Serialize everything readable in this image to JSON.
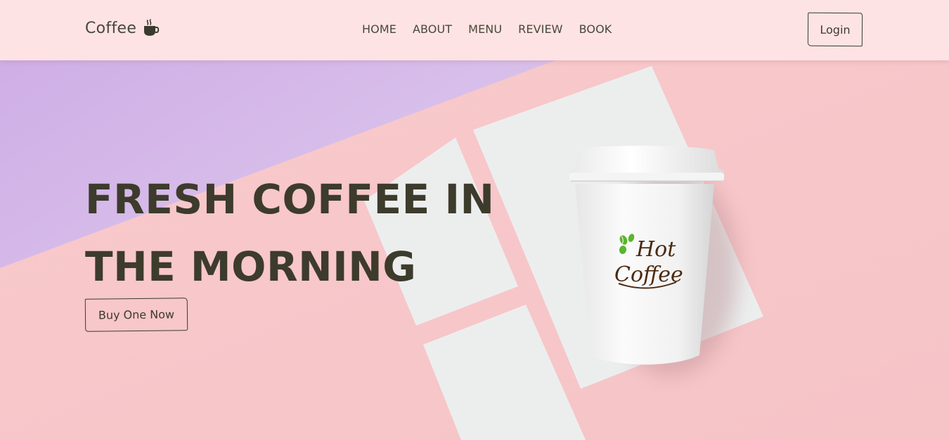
{
  "header": {
    "logo_text": "Coffee",
    "logo_icon": "coffee-cup-icon",
    "nav": [
      {
        "label": "HOME"
      },
      {
        "label": "ABOUT"
      },
      {
        "label": "MENU"
      },
      {
        "label": "REVIEW"
      },
      {
        "label": "BOOK"
      }
    ],
    "login_label": "Login"
  },
  "hero": {
    "title_line1": "FRESH COFFEE IN",
    "title_line2": "THE MORNING",
    "cta_label": "Buy One Now",
    "cup_brand_line1": "Hot",
    "cup_brand_line2": "Coffee"
  },
  "colors": {
    "header_bg": "#fde3e4",
    "hero_pink": "#f7c6c9",
    "hero_lilac": "#d6b5e6",
    "text_dark": "#3d3b2c",
    "bean_green": "#5bb52e",
    "brand_brown": "#4a2a12"
  }
}
